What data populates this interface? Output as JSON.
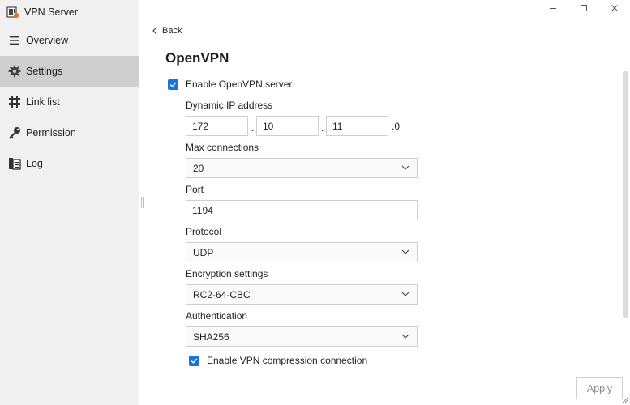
{
  "app": {
    "title": "VPN Server"
  },
  "sidebar": {
    "items": [
      {
        "label": "Overview",
        "icon": "list-icon"
      },
      {
        "label": "Settings",
        "icon": "gear-icon",
        "active": true
      },
      {
        "label": "Link list",
        "icon": "link-list-icon"
      },
      {
        "label": "Permission",
        "icon": "key-icon"
      },
      {
        "label": "Log",
        "icon": "log-icon"
      }
    ]
  },
  "main": {
    "back_label": "Back",
    "title": "OpenVPN",
    "enable_server": {
      "label": "Enable OpenVPN server",
      "checked": true
    },
    "dynamic_ip": {
      "label": "Dynamic IP address",
      "octet1": "172",
      "octet2": "10",
      "octet3": "11",
      "octet4": ".0",
      "dot": "."
    },
    "max_connections": {
      "label": "Max connections",
      "value": "20"
    },
    "port": {
      "label": "Port",
      "value": "1194"
    },
    "protocol": {
      "label": "Protocol",
      "value": "UDP"
    },
    "encryption": {
      "label": "Encryption settings",
      "value": "RC2-64-CBC"
    },
    "authentication": {
      "label": "Authentication",
      "value": "SHA256"
    },
    "compression": {
      "label": "Enable VPN compression connection",
      "checked": true
    },
    "apply_label": "Apply"
  },
  "colors": {
    "accent": "#1a73d9",
    "sidebar_bg": "#f0f0f0",
    "active_bg": "#cfcfcf"
  }
}
